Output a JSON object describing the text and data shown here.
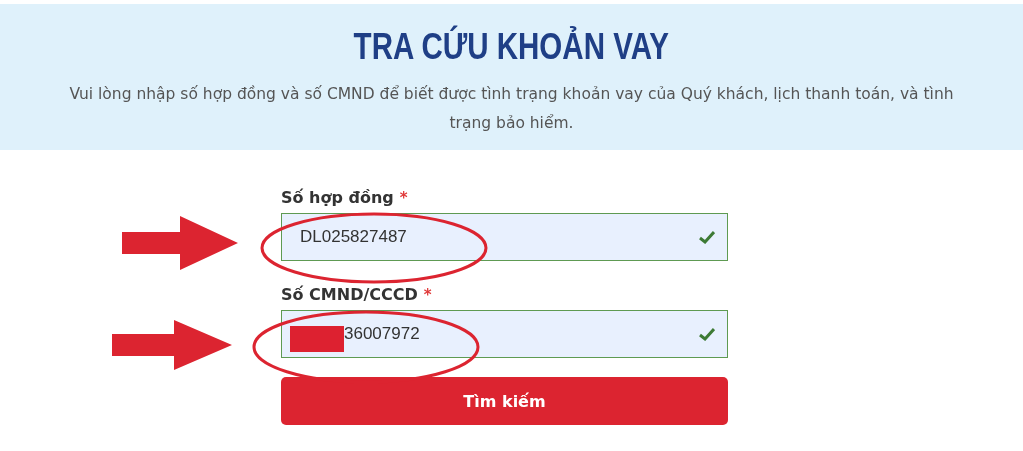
{
  "header": {
    "title": "TRA CỨU KHOẢN VAY",
    "description": "Vui lòng nhập số hợp đồng và số CMND để biết được tình trạng khoản vay của Quý khách, lịch thanh toán, và tình trạng bảo hiểm."
  },
  "fields": [
    {
      "label": "Số hợp đồng",
      "required_mark": "*",
      "value": "DL025827487",
      "valid": true,
      "redacted": false
    },
    {
      "label": "Số CMND/CCCD",
      "required_mark": "*",
      "value": "36007972",
      "valid": true,
      "redacted": true
    }
  ],
  "submit_button": "Tìm kiếm"
}
